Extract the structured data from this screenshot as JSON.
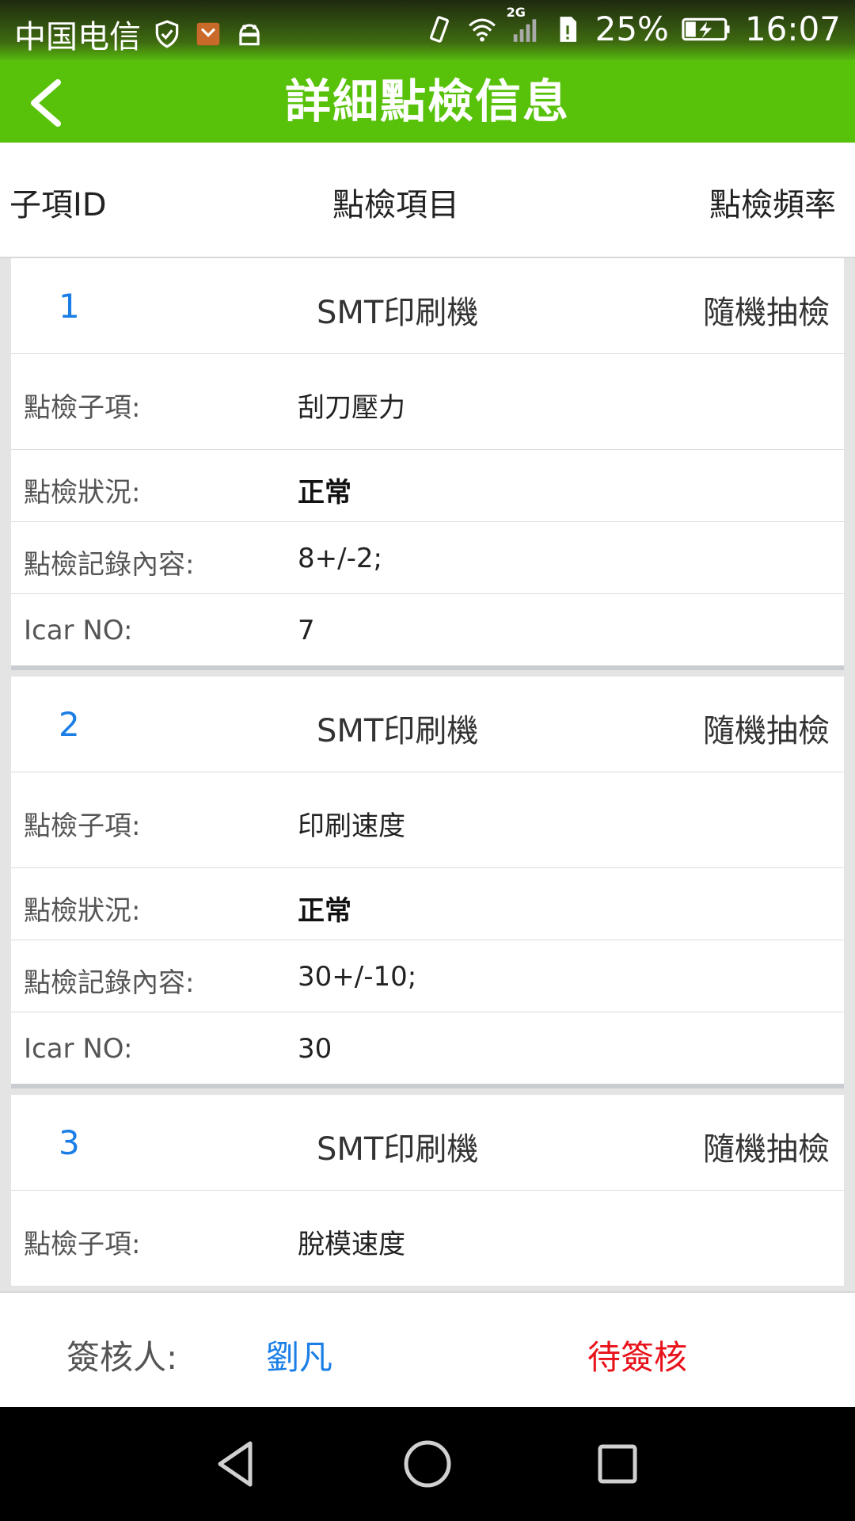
{
  "status_bar": {
    "carrier": "中国电信",
    "network_badge": "2G",
    "battery": "25%",
    "time": "16:07",
    "icons": [
      "shield-check-icon",
      "app-notification-icon",
      "android-icon",
      "vibrate-icon",
      "wifi-icon",
      "signal-icon",
      "sim-icon",
      "battery-charging-icon"
    ]
  },
  "app_bar": {
    "title": "詳細點檢信息",
    "back_icon": "chevron-left-icon"
  },
  "columns": {
    "id": "子項ID",
    "item": "點檢項目",
    "frequency": "點檢頻率"
  },
  "labels": {
    "sub_item": "點檢子項:",
    "status": "點檢狀況:",
    "record": "點檢記錄內容:",
    "icar": "Icar NO:"
  },
  "records": [
    {
      "id": "1",
      "item": "SMT印刷機",
      "frequency": "隨機抽檢",
      "sub_item": "刮刀壓力",
      "status": "正常",
      "record": "8+/-2;",
      "icar": "7"
    },
    {
      "id": "2",
      "item": "SMT印刷機",
      "frequency": "隨機抽檢",
      "sub_item": "印刷速度",
      "status": "正常",
      "record": "30+/-10;",
      "icar": "30"
    },
    {
      "id": "3",
      "item": "SMT印刷機",
      "frequency": "隨機抽檢",
      "sub_item": "脫模速度"
    }
  ],
  "footer": {
    "approver_label": "簽核人:",
    "approver_name": "劉凡",
    "approval_status": "待簽核"
  },
  "colors": {
    "app_bar": "#58c20a",
    "id_blue": "#1a7ee6",
    "pending_red": "#e8121a"
  }
}
